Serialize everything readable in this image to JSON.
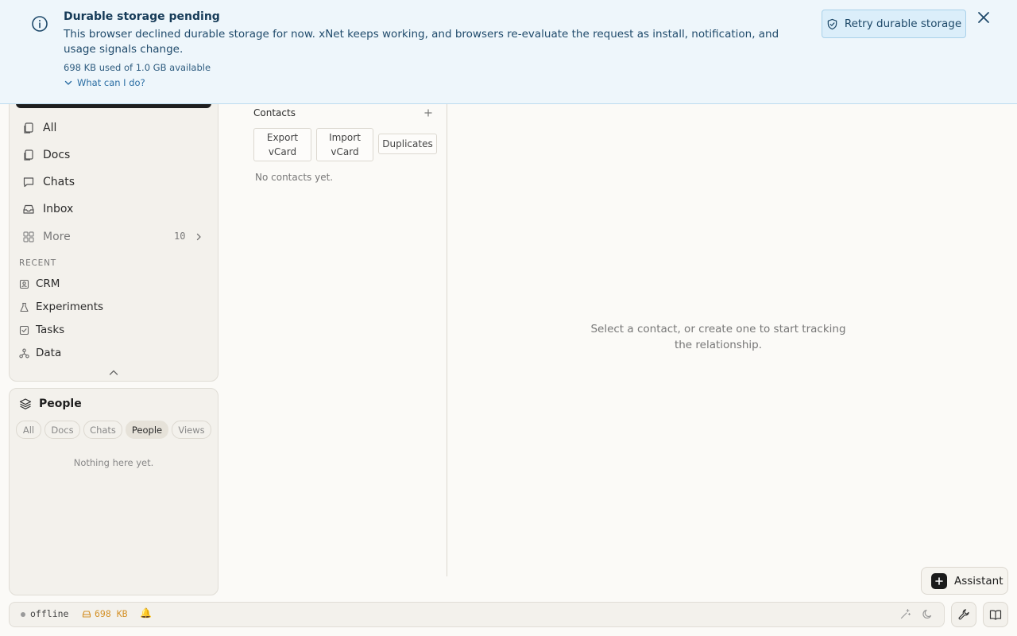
{
  "banner": {
    "title": "Durable storage pending",
    "message": "This browser declined durable storage for now. xNet keeps working, and browsers re-evaluate the request as install, notification, and usage signals change.",
    "usage": "698 KB used of 1.0 GB available",
    "help_label": "What can I do?",
    "retry_label": "Retry durable storage",
    "accent": "#1f4a6b"
  },
  "nav": {
    "items": [
      {
        "label": "All",
        "icon": "copy-icon"
      },
      {
        "label": "Docs",
        "icon": "copy-icon"
      },
      {
        "label": "Chats",
        "icon": "chat-icon"
      },
      {
        "label": "Inbox",
        "icon": "inbox-icon"
      }
    ],
    "more_label": "More",
    "more_count": "10"
  },
  "recent": {
    "heading": "RECENT",
    "items": [
      {
        "label": "CRM",
        "icon": "contact-card-icon"
      },
      {
        "label": "Experiments",
        "icon": "flask-icon"
      },
      {
        "label": "Tasks",
        "icon": "checkbox-icon"
      },
      {
        "label": "Data",
        "icon": "network-icon"
      }
    ]
  },
  "people": {
    "title": "People",
    "filters": [
      "All",
      "Docs",
      "Chats",
      "People",
      "Views"
    ],
    "active_filter": "People",
    "empty": "Nothing here yet."
  },
  "contacts": {
    "heading": "Contacts",
    "buttons": {
      "export": "Export vCard",
      "import": "Import vCard",
      "duplicates": "Duplicates"
    },
    "empty": "No contacts yet."
  },
  "detail": {
    "empty": "Select a contact, or create one to start tracking the relationship."
  },
  "assistant": {
    "label": "Assistant"
  },
  "status": {
    "connection": "offline",
    "storage": "698 KB",
    "bell": "🔔"
  }
}
